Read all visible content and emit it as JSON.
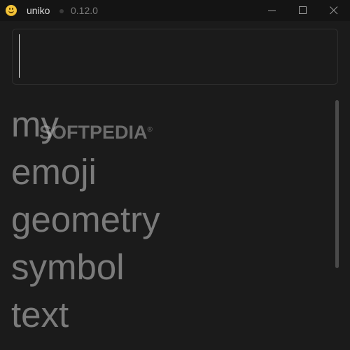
{
  "window": {
    "title": "uniko",
    "version": "0.12.0",
    "controls": {
      "minimize_icon": "minimize-icon",
      "maximize_icon": "maximize-icon",
      "close_icon": "close-icon"
    }
  },
  "search": {
    "value": "",
    "placeholder": ""
  },
  "categories": [
    {
      "label": "my"
    },
    {
      "label": "emoji"
    },
    {
      "label": "geometry"
    },
    {
      "label": "symbol"
    },
    {
      "label": "text"
    }
  ],
  "watermark": {
    "text": "SOFTPEDIA",
    "mark": "®"
  },
  "colors": {
    "background": "#1b1b1b",
    "titlebar": "#141414",
    "category_text": "#7b7b7b",
    "app_icon": "#f3c43a"
  }
}
